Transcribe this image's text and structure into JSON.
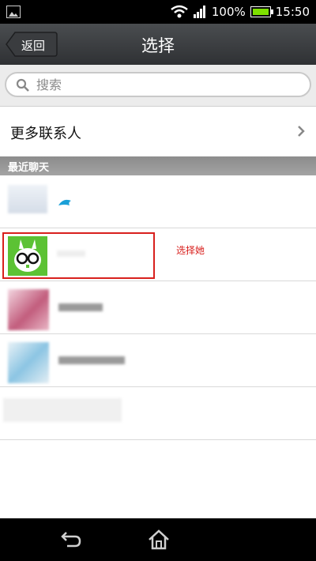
{
  "status_bar": {
    "battery": "100%",
    "time": "15:50"
  },
  "header": {
    "back_label": "返回",
    "title": "选择"
  },
  "search": {
    "placeholder": "搜索"
  },
  "more_contacts": {
    "label": "更多联系人"
  },
  "recent_section": {
    "label": "最近聊天"
  },
  "annotation": {
    "text": "选择她",
    "color": "#d8201d"
  },
  "colors": {
    "accent_green": "#5cc234",
    "highlight_red": "#d8201d",
    "titlebar": "#3b3e41"
  }
}
